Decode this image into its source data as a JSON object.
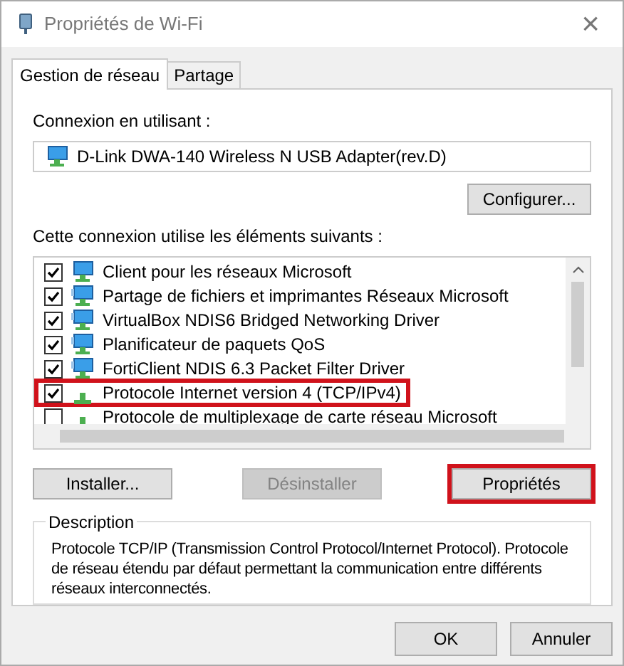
{
  "window": {
    "title": "Propriétés de Wi-Fi",
    "close": "×"
  },
  "tabs": [
    {
      "label": "Gestion de réseau",
      "selected": true
    },
    {
      "label": "Partage",
      "selected": false
    }
  ],
  "connection": {
    "label": "Connexion en utilisant :",
    "adapter": "D-Link DWA-140 Wireless N USB Adapter(rev.D)",
    "button": "Configurer..."
  },
  "components": {
    "label": "Cette connexion utilise les éléments suivants :",
    "items": [
      {
        "name": "Client pour les réseaux Microsoft",
        "checked": true,
        "highlighted": false,
        "kind": "network"
      },
      {
        "name": "Partage de fichiers et imprimantes Réseaux Microsoft",
        "checked": true,
        "highlighted": false,
        "kind": "service"
      },
      {
        "name": "VirtualBox NDIS6 Bridged Networking Driver",
        "checked": true,
        "highlighted": false,
        "kind": "service"
      },
      {
        "name": "Planificateur de paquets QoS",
        "checked": true,
        "highlighted": false,
        "kind": "service"
      },
      {
        "name": "FortiClient NDIS 6.3 Packet Filter Driver",
        "checked": true,
        "highlighted": false,
        "kind": "service"
      },
      {
        "name": "Protocole Internet version 4 (TCP/IPv4)",
        "checked": true,
        "highlighted": true,
        "kind": "protocol"
      },
      {
        "name": "Protocole de multiplexage de carte réseau Microsoft",
        "checked": false,
        "highlighted": false,
        "kind": "protocol"
      }
    ]
  },
  "actions": [
    {
      "label": "Installer...",
      "disabled": false,
      "highlighted": false
    },
    {
      "label": "Désinstaller",
      "disabled": true,
      "highlighted": false
    },
    {
      "label": "Propriétés",
      "disabled": false,
      "highlighted": true
    }
  ],
  "description": {
    "title": "Description",
    "text": "Protocole TCP/IP (Transmission Control Protocol/Internet Protocol). Protocole de réseau étendu par défaut permettant la communication entre différents réseaux interconnectés."
  },
  "buttons": [
    "OK",
    "Annuler"
  ]
}
